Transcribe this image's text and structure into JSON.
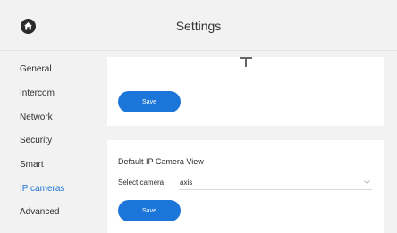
{
  "header": {
    "title": "Settings",
    "home_icon": "home-icon"
  },
  "sidebar": {
    "items": [
      {
        "label": "General"
      },
      {
        "label": "Intercom"
      },
      {
        "label": "Network"
      },
      {
        "label": "Security"
      },
      {
        "label": "Smart"
      },
      {
        "label": "IP cameras",
        "active": true
      },
      {
        "label": "Advanced"
      }
    ]
  },
  "card1": {
    "save_label": "Save"
  },
  "card2": {
    "title": "Default IP Camera View",
    "select_label": "Select camera",
    "select_value": "axis",
    "save_label": "Save"
  },
  "colors": {
    "accent": "#1c75d8",
    "active_nav": "#1e73d6",
    "background": "#f2f2f2",
    "card": "#ffffff"
  }
}
